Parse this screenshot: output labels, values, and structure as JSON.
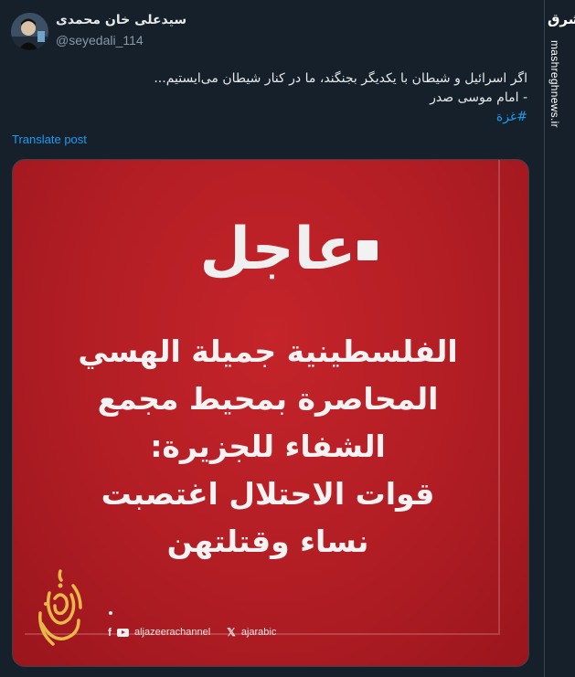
{
  "author": {
    "display_name": "سیدعلی خان محمدی",
    "handle": "@seyedali_114"
  },
  "tweet": {
    "line1": "اگر اسرائیل و شیطان با یکدیگر بجنگند، ما در کنار شیطان می‌ایستیم...",
    "line2": "- امام موسی صدر",
    "hashtag": "#غزة",
    "translate_label": "Translate post"
  },
  "media": {
    "urgent_label": "عاجل",
    "headline_lines": [
      "الفلسطينية جميلة الهسي",
      "المحاصرة بمحيط مجمع",
      "الشفاء للجزيرة:",
      "قوات الاحتلال اغتصبت",
      "نساء وقتلتهن"
    ],
    "social_facebook_youtube": "aljazeerachannel",
    "social_x": "ajarabic",
    "logo_icon": "aljazeera-logo"
  },
  "watermark": {
    "logo_text": "مشرق",
    "site": "mashreghnews.ir"
  },
  "colors": {
    "background": "#15202b",
    "accent_blue": "#1d9bf0",
    "card_red": "#b11d24"
  }
}
